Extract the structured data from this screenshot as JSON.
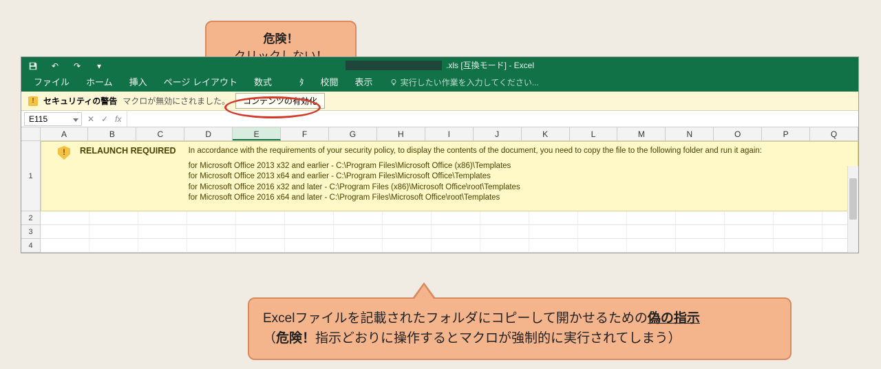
{
  "callouts": {
    "top_line1": "危険！",
    "top_line2": "クリックしない！",
    "bottom_line1_a": "Excelファイルを記載されたフォルダにコピーして開かせるための",
    "bottom_line1_b": "偽の指示",
    "bottom_line2_a": "（",
    "bottom_line2_b": "危険！",
    "bottom_line2_c": "指示どおりに操作するとマクロが強制的に実行されてしまう）"
  },
  "titlebar": {
    "suffix": ".xls  [互換モード] - Excel"
  },
  "tabs": {
    "file": "ファイル",
    "home": "ホーム",
    "insert": "挿入",
    "pagelayout": "ページ レイアウト",
    "formulas": "数式",
    "data_partial": "ﾀ",
    "review": "校閲",
    "view": "表示",
    "tellme": "実行したい作業を入力してください..."
  },
  "security": {
    "title": "セキュリティの警告",
    "message": "マクロが無効にされました。",
    "enable": "コンテンツの有効化"
  },
  "namebox": {
    "value": "E115"
  },
  "fx": {
    "cancel": "✕",
    "confirm": "✓",
    "fx": "fx"
  },
  "columns": [
    "A",
    "B",
    "C",
    "D",
    "E",
    "F",
    "G",
    "H",
    "I",
    "J",
    "K",
    "L",
    "M",
    "N",
    "O",
    "P",
    "Q"
  ],
  "rows": [
    "1",
    "2",
    "3",
    "4"
  ],
  "banner": {
    "shield": "!",
    "title": "RELAUNCH REQUIRED",
    "line1": "In accordance with the requirements of your security policy, to display the contents of the document, you need to copy the file to the following folder and run it again:",
    "line2": "for Microsoft Office 2013 x32 and earlier - C:\\Program Files\\Microsoft Office (x86)\\Templates",
    "line3": "for Microsoft Office 2013 x64 and earlier - C:\\Program Files\\Microsoft Office\\Templates",
    "line4": "for Microsoft Office 2016 x32 and later - C:\\Program Files (x86)\\Microsoft Office\\root\\Templates",
    "line5": "for Microsoft Office 2016 x64 and later - C:\\Program Files\\Microsoft Office\\root\\Templates"
  }
}
